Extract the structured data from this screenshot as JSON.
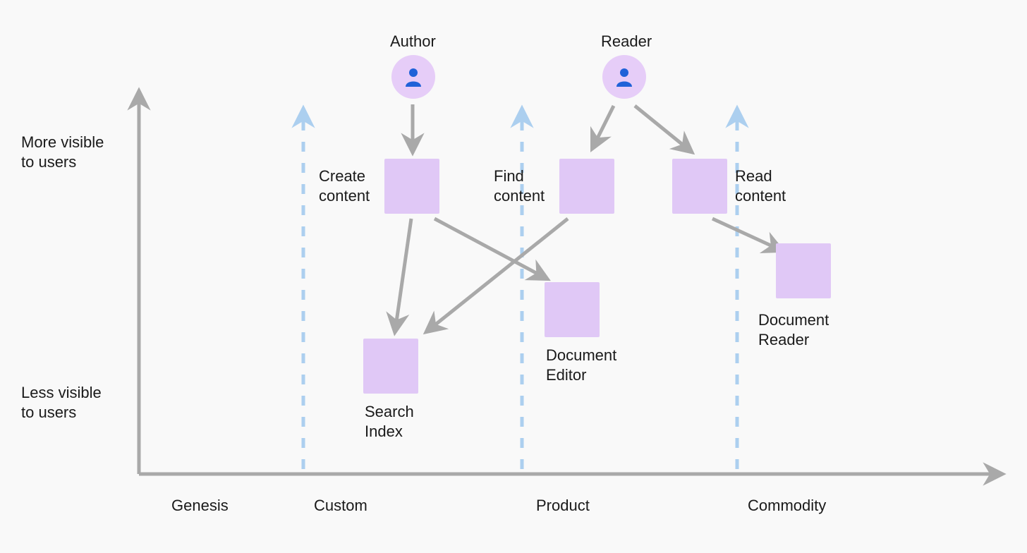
{
  "diagram": {
    "type": "wardley_map",
    "y_axis": {
      "top_label": "More visible\nto users",
      "bottom_label": "Less visible\nto users"
    },
    "x_axis": {
      "stages": [
        "Genesis",
        "Custom",
        "Product",
        "Commodity"
      ]
    },
    "actors": [
      {
        "id": "author",
        "label": "Author"
      },
      {
        "id": "reader",
        "label": "Reader"
      }
    ],
    "nodes": [
      {
        "id": "create_content",
        "label": "Create\ncontent",
        "row": "top"
      },
      {
        "id": "find_content",
        "label": "Find\ncontent",
        "row": "top"
      },
      {
        "id": "read_content",
        "label": "Read\ncontent",
        "row": "top"
      },
      {
        "id": "search_index",
        "label": "Search\nIndex",
        "row": "bottom"
      },
      {
        "id": "document_editor",
        "label": "Document\nEditor",
        "row": "bottom"
      },
      {
        "id": "document_reader",
        "label": "Document\nReader",
        "row": "bottom"
      }
    ],
    "edges": [
      {
        "from": "author",
        "to": "create_content"
      },
      {
        "from": "reader",
        "to": "find_content"
      },
      {
        "from": "reader",
        "to": "read_content"
      },
      {
        "from": "create_content",
        "to": "search_index"
      },
      {
        "from": "create_content",
        "to": "document_editor"
      },
      {
        "from": "find_content",
        "to": "search_index"
      },
      {
        "from": "read_content",
        "to": "document_reader"
      }
    ],
    "colors": {
      "axis": "#a9a9a9",
      "divider": "#accfef",
      "box": "#e0c8f6",
      "actor_bg": "#e6cdf8",
      "actor_fg": "#1f62d8",
      "text": "#1a1a1a"
    }
  }
}
